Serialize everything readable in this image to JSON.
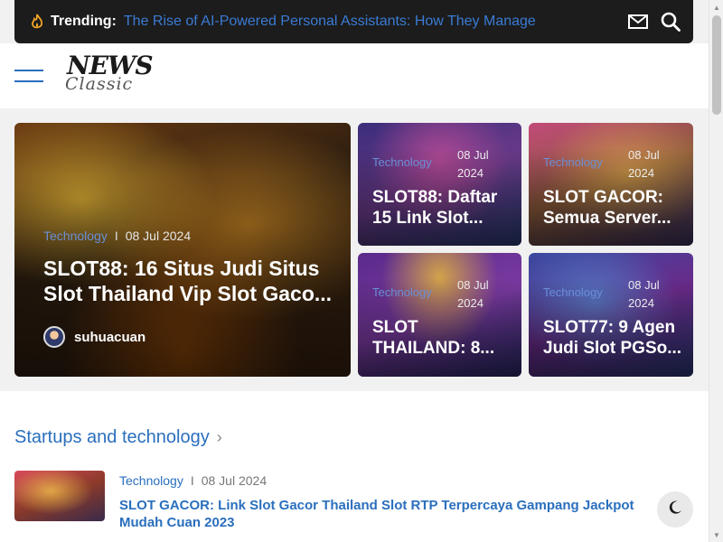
{
  "trending": {
    "label": "Trending:",
    "headline": "The Rise of AI-Powered Personal Assistants: How They Manage"
  },
  "header": {
    "logo_top": "NEWS",
    "logo_bottom": "Classic"
  },
  "hero": {
    "main": {
      "category": "Technology",
      "separator": "I",
      "date": "08 Jul 2024",
      "title": "SLOT88: 16 Situs Judi Situs Slot Thailand Vip Slot Gaco...",
      "author": "suhuacuan"
    },
    "small": [
      {
        "category": "Technology",
        "date": "08 Jul 2024",
        "title": "SLOT88: Daftar 15 Link Slot..."
      },
      {
        "category": "Technology",
        "date": "08 Jul 2024",
        "title": "SLOT GACOR: Semua Server..."
      },
      {
        "category": "Technology",
        "date": "08 Jul 2024",
        "title": "SLOT THAILAND: 8..."
      },
      {
        "category": "Technology",
        "date": "08 Jul 2024",
        "title": "SLOT77: 9 Agen Judi Slot PGSo..."
      }
    ]
  },
  "section": {
    "title": "Startups and technology",
    "chevron": "›",
    "post": {
      "category": "Technology",
      "separator": "I",
      "date": "08 Jul 2024",
      "title": "SLOT GACOR: Link Slot Gacor Thailand Slot RTP Terpercaya Gampang Jackpot Mudah Cuan 2023"
    }
  },
  "colors": {
    "accent": "#2a6fbd",
    "trending_bg": "#1c1c1c",
    "page_bg": "#f1f1f1"
  },
  "icons": {
    "trending": "flame-icon",
    "mail": "mail-icon",
    "search": "search-icon",
    "menu": "hamburger-icon",
    "dark_mode": "moon-icon"
  }
}
